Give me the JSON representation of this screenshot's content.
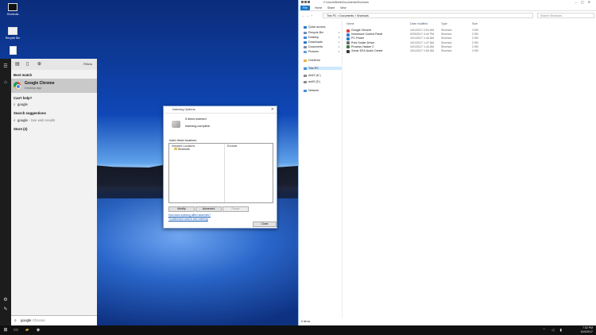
{
  "desktop": {
    "icons": [
      {
        "label": "Shortcuts",
        "icon": "monitor-icon"
      },
      {
        "label": "Recycle Bin",
        "icon": "recycle-bin-icon"
      }
    ]
  },
  "start": {
    "filters_label": "Filters",
    "best_match_header": "Best match",
    "best_match": {
      "title": "Google Chrome",
      "subtitle": "Desktop app"
    },
    "cant_find_header": "Can't help?",
    "cant_find_item": "google",
    "suggestions_header": "Search suggestions",
    "suggestion": {
      "term": "google",
      "hint": "- See web results"
    },
    "store_header": "Store (2)",
    "search_query": "google",
    "search_completion": " Chrome"
  },
  "indexing": {
    "title": "Indexing Options",
    "count_text": "5 items indexed",
    "status_text": "Indexing complete.",
    "index_label": "Index these locations:",
    "col_included": "Included Locations",
    "col_exclude": "Exclude",
    "locations": [
      "Shortcuts"
    ],
    "modify_label": "Modify",
    "advanced_label": "Advanced",
    "pause_label": "Pause",
    "link1": "How does indexing affect searches?",
    "link2": "Troubleshoot search and indexing",
    "close_label": "Close"
  },
  "explorer": {
    "title_path": "C:\\Users\\Brink\\Documents\\Shortcuts",
    "ribbon_tabs": [
      "File",
      "Home",
      "Share",
      "View"
    ],
    "address": "This PC  >  Documents  >  Shortcuts",
    "search_placeholder": "Search Shortcuts",
    "nav": [
      {
        "label": "Quick access",
        "color": "#2b7cd3",
        "pin": ""
      },
      {
        "label": "Recycle Bin",
        "color": "#6a8fb6",
        "pin": "★"
      },
      {
        "label": "Desktop",
        "color": "#3c8dde",
        "pin": "★"
      },
      {
        "label": "Downloads",
        "color": "#2b7cd3",
        "pin": "★"
      },
      {
        "label": "Documents",
        "color": "#7a8da3",
        "pin": "★"
      },
      {
        "label": "Pictures",
        "color": "#6aa0d8",
        "pin": "★"
      },
      {
        "label": "OneDrive",
        "color": "#e6b445",
        "pin": ""
      },
      {
        "label": "This PC",
        "color": "#4a8fd6",
        "pin": ""
      },
      {
        "label": "AntIS (E:)",
        "color": "#8a8a8a",
        "pin": ""
      },
      {
        "label": "antIS (E:)",
        "color": "#8a8a8a",
        "pin": ""
      },
      {
        "label": "Network",
        "color": "#4a8fd6",
        "pin": ""
      }
    ],
    "columns": [
      "Name",
      "Date modified",
      "Type",
      "Size"
    ],
    "files": [
      {
        "name": "Google Chrome",
        "date": "10/1/2017 2:51 AM",
        "type": "Shortcut",
        "size": "3 KB",
        "color": "#db4437"
      },
      {
        "name": "Immersive Control Panel",
        "date": "9/29/2017 4:42 PM",
        "type": "Shortcut",
        "size": "2 KB",
        "color": "#2b7cd3"
      },
      {
        "name": "PC Power",
        "date": "10/1/2017 1:44 AM",
        "type": "Shortcut",
        "size": "2 KB",
        "color": "#2b7cd3"
      },
      {
        "name": "Print Solder Driver",
        "date": "10/1/2017 1:47 AM",
        "type": "Shortcut",
        "size": "2 KB",
        "color": "#6b6b6b"
      },
      {
        "name": "Process Hacker 2",
        "date": "10/1/2017 1:44 AM",
        "type": "Shortcut",
        "size": "2 KB",
        "color": "#3a7d3a"
      },
      {
        "name": "Xonar DSX Audio Center",
        "date": "10/1/2017 1:50 AM",
        "type": "Shortcut",
        "size": "2 KB",
        "color": "#3a3a3a"
      }
    ],
    "status": "6 items"
  },
  "taskbar": {
    "time": "7:32 PM",
    "date": "10/4/2017"
  }
}
